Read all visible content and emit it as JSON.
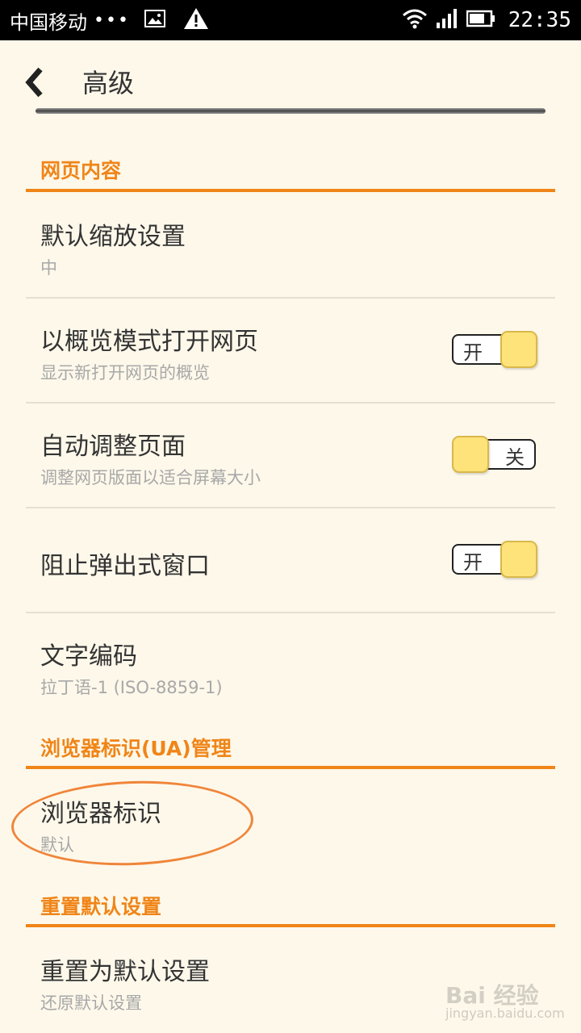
{
  "status_bar": {
    "carrier": "中国移动",
    "dots": "•••",
    "time": "22:35"
  },
  "header": {
    "title": "高级",
    "back_icon": "chevron-left-icon"
  },
  "sections": {
    "web_content": {
      "title": "网页内容",
      "default_zoom": {
        "title": "默认缩放设置",
        "value": "中"
      },
      "overview_mode": {
        "title": "以概览模式打开网页",
        "subtitle": "显示新打开网页的概览",
        "toggle_label": "开",
        "on": true
      },
      "auto_fit": {
        "title": "自动调整页面",
        "subtitle": "调整网页版面以适合屏幕大小",
        "toggle_label": "关",
        "on": false
      },
      "block_popups": {
        "title": "阻止弹出式窗口",
        "toggle_label": "开",
        "on": true
      },
      "text_encoding": {
        "title": "文字编码",
        "value": "拉丁语-1 (ISO-8859-1)"
      }
    },
    "ua_management": {
      "title": "浏览器标识(UA)管理",
      "user_agent": {
        "title": "浏览器标识",
        "value": "默认"
      }
    },
    "reset": {
      "title": "重置默认设置",
      "reset_defaults": {
        "title": "重置为默认设置",
        "subtitle": "还原默认设置"
      }
    }
  },
  "watermark": {
    "brand": "Bai 经验",
    "url": "jingyan.baidu.com"
  },
  "colors": {
    "accent": "#f08518",
    "toggle_knob": "#fde37a",
    "background": "#fdf8ea"
  }
}
